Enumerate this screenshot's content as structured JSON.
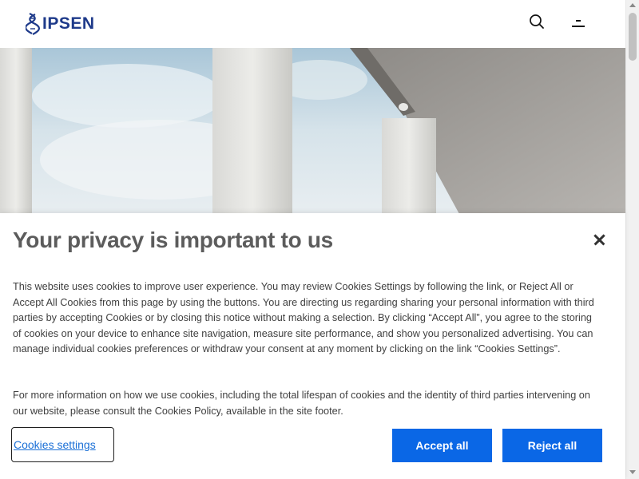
{
  "header": {
    "logo_text": "IPSEN",
    "brand_color": "#1e3a8a",
    "search_icon": "search-icon",
    "menu_icon": "menu-icon"
  },
  "hero": {
    "description_icon": "hero-image"
  },
  "cookie_banner": {
    "title": "Your privacy is important to us",
    "paragraph_1": "This website uses cookies to improve user experience. You may review Cookies Settings by following the link, or Reject All or Accept All Cookies from this page by using the buttons. You are directing us regarding sharing your personal information with third parties by accepting Cookies or by closing this notice without making a selection. By clicking “Accept All”, you agree to the storing of cookies on your device to enhance site navigation, measure site performance, and show you personalized advertising. You can manage individual cookies preferences or withdraw your consent at any moment by clicking on the link “Cookies Settings”.",
    "paragraph_2": "For more information on how we use cookies, including the total lifespan of cookies and the identity of third parties intervening on our website, please consult the Cookies Policy, available in the site footer.",
    "settings_label": "Cookies settings",
    "accept_label": "Accept all",
    "reject_label": "Reject all",
    "button_color": "#0a67e6",
    "link_color": "#1a6fd6"
  }
}
